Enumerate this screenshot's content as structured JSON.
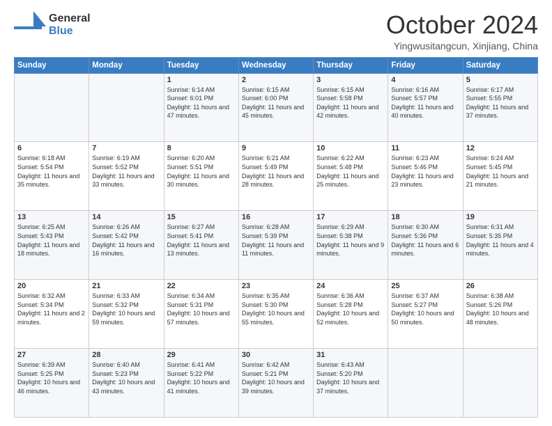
{
  "header": {
    "logo_general": "General",
    "logo_blue": "Blue",
    "month_title": "October 2024",
    "location": "Yingwusitangcun, Xinjiang, China"
  },
  "days_of_week": [
    "Sunday",
    "Monday",
    "Tuesday",
    "Wednesday",
    "Thursday",
    "Friday",
    "Saturday"
  ],
  "weeks": [
    [
      {
        "day": "",
        "sunrise": "",
        "sunset": "",
        "daylight": ""
      },
      {
        "day": "",
        "sunrise": "",
        "sunset": "",
        "daylight": ""
      },
      {
        "day": "1",
        "sunrise": "Sunrise: 6:14 AM",
        "sunset": "Sunset: 6:01 PM",
        "daylight": "Daylight: 11 hours and 47 minutes."
      },
      {
        "day": "2",
        "sunrise": "Sunrise: 6:15 AM",
        "sunset": "Sunset: 6:00 PM",
        "daylight": "Daylight: 11 hours and 45 minutes."
      },
      {
        "day": "3",
        "sunrise": "Sunrise: 6:15 AM",
        "sunset": "Sunset: 5:58 PM",
        "daylight": "Daylight: 11 hours and 42 minutes."
      },
      {
        "day": "4",
        "sunrise": "Sunrise: 6:16 AM",
        "sunset": "Sunset: 5:57 PM",
        "daylight": "Daylight: 11 hours and 40 minutes."
      },
      {
        "day": "5",
        "sunrise": "Sunrise: 6:17 AM",
        "sunset": "Sunset: 5:55 PM",
        "daylight": "Daylight: 11 hours and 37 minutes."
      }
    ],
    [
      {
        "day": "6",
        "sunrise": "Sunrise: 6:18 AM",
        "sunset": "Sunset: 5:54 PM",
        "daylight": "Daylight: 11 hours and 35 minutes."
      },
      {
        "day": "7",
        "sunrise": "Sunrise: 6:19 AM",
        "sunset": "Sunset: 5:52 PM",
        "daylight": "Daylight: 11 hours and 33 minutes."
      },
      {
        "day": "8",
        "sunrise": "Sunrise: 6:20 AM",
        "sunset": "Sunset: 5:51 PM",
        "daylight": "Daylight: 11 hours and 30 minutes."
      },
      {
        "day": "9",
        "sunrise": "Sunrise: 6:21 AM",
        "sunset": "Sunset: 5:49 PM",
        "daylight": "Daylight: 11 hours and 28 minutes."
      },
      {
        "day": "10",
        "sunrise": "Sunrise: 6:22 AM",
        "sunset": "Sunset: 5:48 PM",
        "daylight": "Daylight: 11 hours and 25 minutes."
      },
      {
        "day": "11",
        "sunrise": "Sunrise: 6:23 AM",
        "sunset": "Sunset: 5:46 PM",
        "daylight": "Daylight: 11 hours and 23 minutes."
      },
      {
        "day": "12",
        "sunrise": "Sunrise: 6:24 AM",
        "sunset": "Sunset: 5:45 PM",
        "daylight": "Daylight: 11 hours and 21 minutes."
      }
    ],
    [
      {
        "day": "13",
        "sunrise": "Sunrise: 6:25 AM",
        "sunset": "Sunset: 5:43 PM",
        "daylight": "Daylight: 11 hours and 18 minutes."
      },
      {
        "day": "14",
        "sunrise": "Sunrise: 6:26 AM",
        "sunset": "Sunset: 5:42 PM",
        "daylight": "Daylight: 11 hours and 16 minutes."
      },
      {
        "day": "15",
        "sunrise": "Sunrise: 6:27 AM",
        "sunset": "Sunset: 5:41 PM",
        "daylight": "Daylight: 11 hours and 13 minutes."
      },
      {
        "day": "16",
        "sunrise": "Sunrise: 6:28 AM",
        "sunset": "Sunset: 5:39 PM",
        "daylight": "Daylight: 11 hours and 11 minutes."
      },
      {
        "day": "17",
        "sunrise": "Sunrise: 6:29 AM",
        "sunset": "Sunset: 5:38 PM",
        "daylight": "Daylight: 11 hours and 9 minutes."
      },
      {
        "day": "18",
        "sunrise": "Sunrise: 6:30 AM",
        "sunset": "Sunset: 5:36 PM",
        "daylight": "Daylight: 11 hours and 6 minutes."
      },
      {
        "day": "19",
        "sunrise": "Sunrise: 6:31 AM",
        "sunset": "Sunset: 5:35 PM",
        "daylight": "Daylight: 11 hours and 4 minutes."
      }
    ],
    [
      {
        "day": "20",
        "sunrise": "Sunrise: 6:32 AM",
        "sunset": "Sunset: 5:34 PM",
        "daylight": "Daylight: 11 hours and 2 minutes."
      },
      {
        "day": "21",
        "sunrise": "Sunrise: 6:33 AM",
        "sunset": "Sunset: 5:32 PM",
        "daylight": "Daylight: 10 hours and 59 minutes."
      },
      {
        "day": "22",
        "sunrise": "Sunrise: 6:34 AM",
        "sunset": "Sunset: 5:31 PM",
        "daylight": "Daylight: 10 hours and 57 minutes."
      },
      {
        "day": "23",
        "sunrise": "Sunrise: 6:35 AM",
        "sunset": "Sunset: 5:30 PM",
        "daylight": "Daylight: 10 hours and 55 minutes."
      },
      {
        "day": "24",
        "sunrise": "Sunrise: 6:36 AM",
        "sunset": "Sunset: 5:28 PM",
        "daylight": "Daylight: 10 hours and 52 minutes."
      },
      {
        "day": "25",
        "sunrise": "Sunrise: 6:37 AM",
        "sunset": "Sunset: 5:27 PM",
        "daylight": "Daylight: 10 hours and 50 minutes."
      },
      {
        "day": "26",
        "sunrise": "Sunrise: 6:38 AM",
        "sunset": "Sunset: 5:26 PM",
        "daylight": "Daylight: 10 hours and 48 minutes."
      }
    ],
    [
      {
        "day": "27",
        "sunrise": "Sunrise: 6:39 AM",
        "sunset": "Sunset: 5:25 PM",
        "daylight": "Daylight: 10 hours and 46 minutes."
      },
      {
        "day": "28",
        "sunrise": "Sunrise: 6:40 AM",
        "sunset": "Sunset: 5:23 PM",
        "daylight": "Daylight: 10 hours and 43 minutes."
      },
      {
        "day": "29",
        "sunrise": "Sunrise: 6:41 AM",
        "sunset": "Sunset: 5:22 PM",
        "daylight": "Daylight: 10 hours and 41 minutes."
      },
      {
        "day": "30",
        "sunrise": "Sunrise: 6:42 AM",
        "sunset": "Sunset: 5:21 PM",
        "daylight": "Daylight: 10 hours and 39 minutes."
      },
      {
        "day": "31",
        "sunrise": "Sunrise: 6:43 AM",
        "sunset": "Sunset: 5:20 PM",
        "daylight": "Daylight: 10 hours and 37 minutes."
      },
      {
        "day": "",
        "sunrise": "",
        "sunset": "",
        "daylight": ""
      },
      {
        "day": "",
        "sunrise": "",
        "sunset": "",
        "daylight": ""
      }
    ]
  ]
}
